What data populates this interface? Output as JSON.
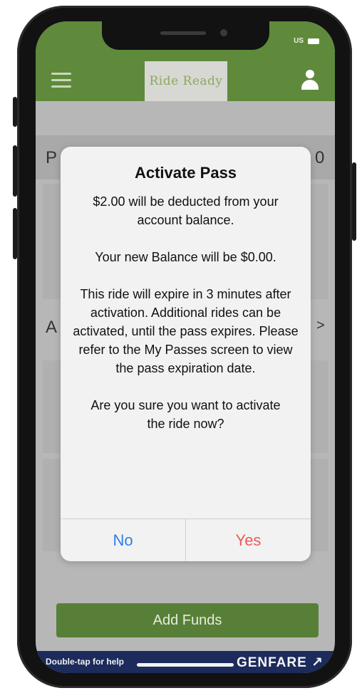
{
  "status_bar": {
    "signal_text": "US"
  },
  "app_bar": {
    "logo_text": "Ride Ready"
  },
  "background": {
    "left_letter_1": "P",
    "right_char_1": "0",
    "left_letter_2": "A",
    "right_char_2": ">"
  },
  "dialog": {
    "title": "Activate Pass",
    "paragraphs": [
      "$2.00 will be deducted from your account balance.",
      "Your new Balance will be $0.00.",
      "This ride will expire in 3 minutes after activation. Additional rides can be activated, until the pass expires. Please refer to the My Passes screen to view the pass expiration date.",
      "Are you sure you want to activate the ride now?"
    ],
    "no_label": "No",
    "yes_label": "Yes",
    "no_color": "#2f7ee6",
    "yes_color": "#ee5a5a"
  },
  "add_funds_label": "Add Funds",
  "footer": {
    "help_text": "Double-tap for help",
    "brand": "GENFARE ↗"
  },
  "colors": {
    "app_green": "#5f8a3b",
    "footer_navy": "#1c2b5c"
  }
}
